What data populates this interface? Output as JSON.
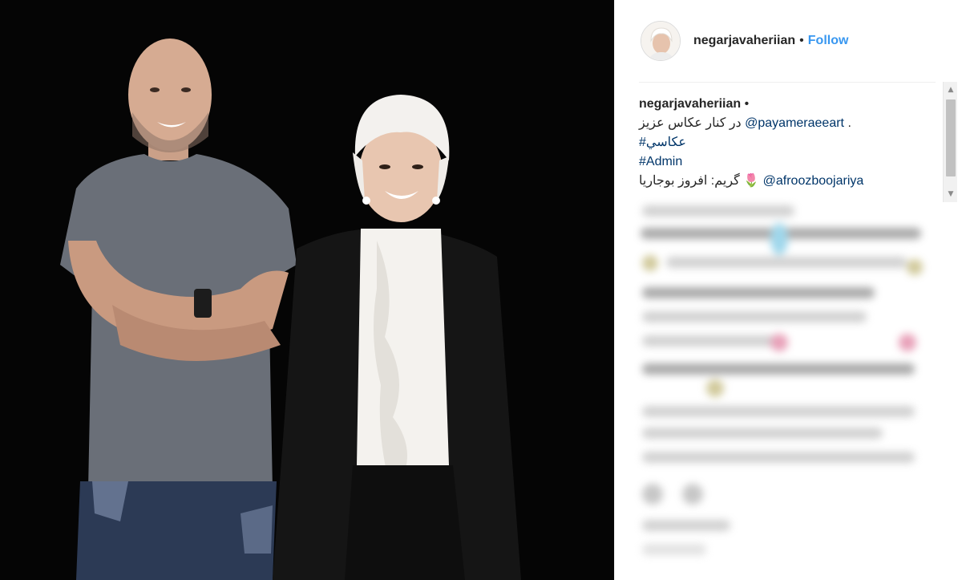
{
  "post": {
    "username": "negarjavaheriian",
    "separator": "•",
    "follow_label": "Follow"
  },
  "caption": {
    "username": "negarjavaheriian",
    "separator": "•",
    "line1_text": "در کنار عکاس عزیز",
    "line1_mention": "@payameraeeart",
    "line1_suffix": " .",
    "line2_hashtag": "#عكاسي",
    "line3_hashtag": "#Admin",
    "line4_text": "گریم: افروز بوجاریا",
    "line4_emoji": "🌷",
    "line4_mention": "@afroozboojariya"
  },
  "colors": {
    "link": "#003569",
    "follow": "#3897f0",
    "photo_bg": "#050505"
  },
  "icons": {
    "scroll_up": "▲",
    "scroll_down": "▼"
  }
}
